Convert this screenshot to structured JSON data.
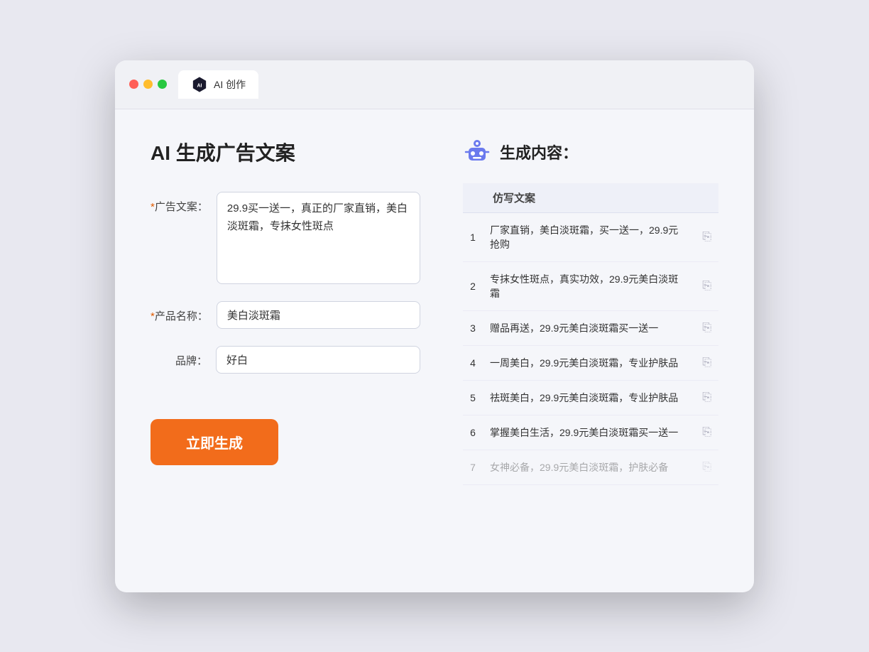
{
  "titlebar": {
    "tab_label": "AI 创作"
  },
  "page": {
    "title": "AI 生成广告文案"
  },
  "form": {
    "ad_copy_label": "广告文案：",
    "ad_copy_required": "*",
    "ad_copy_value": "29.9买一送一，真正的厂家直销，美白淡斑霜，专抹女性斑点",
    "product_name_label": "产品名称：",
    "product_name_required": "*",
    "product_name_value": "美白淡斑霜",
    "brand_label": "品牌：",
    "brand_value": "好白",
    "generate_btn_label": "立即生成"
  },
  "results": {
    "header_label": "生成内容：",
    "column_label": "仿写文案",
    "items": [
      {
        "num": "1",
        "text": "厂家直销，美白淡斑霜，买一送一，29.9元抢购"
      },
      {
        "num": "2",
        "text": "专抹女性斑点，真实功效，29.9元美白淡斑霜"
      },
      {
        "num": "3",
        "text": "赠品再送，29.9元美白淡斑霜买一送一"
      },
      {
        "num": "4",
        "text": "一周美白，29.9元美白淡斑霜，专业护肤品"
      },
      {
        "num": "5",
        "text": "祛斑美白，29.9元美白淡斑霜，专业护肤品"
      },
      {
        "num": "6",
        "text": "掌握美白生活，29.9元美白淡斑霜买一送一"
      },
      {
        "num": "7",
        "text": "女神必备，29.9元美白淡斑霜，护肤必备",
        "faded": true
      }
    ]
  }
}
